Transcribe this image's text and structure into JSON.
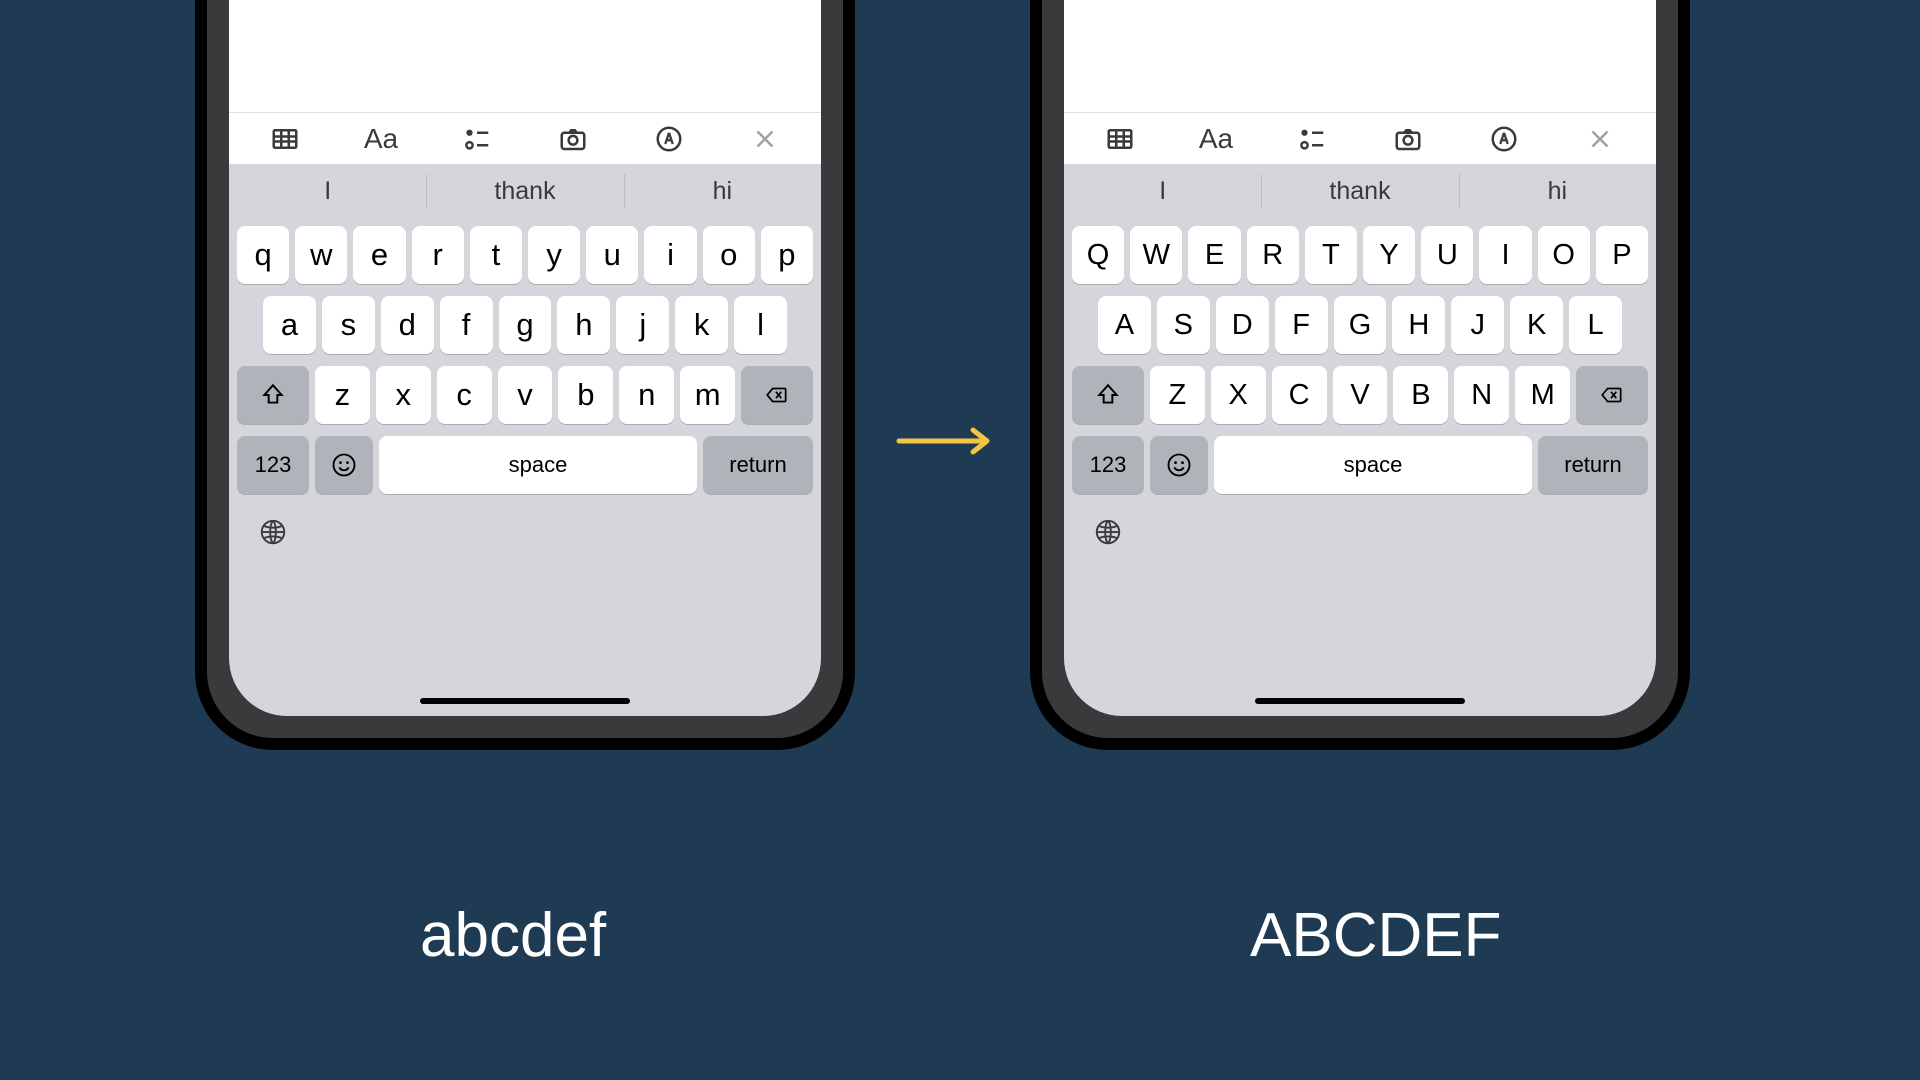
{
  "left": {
    "suggestions": [
      "I",
      "thank",
      "hi"
    ],
    "rows": [
      [
        "q",
        "w",
        "e",
        "r",
        "t",
        "y",
        "u",
        "i",
        "o",
        "p"
      ],
      [
        "a",
        "s",
        "d",
        "f",
        "g",
        "h",
        "j",
        "k",
        "l"
      ],
      [
        "z",
        "x",
        "c",
        "v",
        "b",
        "n",
        "m"
      ]
    ],
    "k123": "123",
    "space": "space",
    "return": "return",
    "caption": "abcdef"
  },
  "right": {
    "suggestions": [
      "I",
      "thank",
      "hi"
    ],
    "rows": [
      [
        "Q",
        "W",
        "E",
        "R",
        "T",
        "Y",
        "U",
        "I",
        "O",
        "P"
      ],
      [
        "A",
        "S",
        "D",
        "F",
        "G",
        "H",
        "J",
        "K",
        "L"
      ],
      [
        "Z",
        "X",
        "C",
        "V",
        "B",
        "N",
        "M"
      ]
    ],
    "k123": "123",
    "space": "space",
    "return": "return",
    "caption": "ABCDEF"
  },
  "toolbar_aa": "Aa"
}
